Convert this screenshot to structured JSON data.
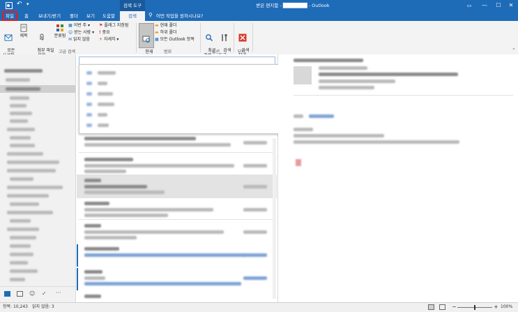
{
  "titlebar": {
    "context_tab": "검색 도구",
    "window_title": "받은 편지함 - ███████ - Outlook",
    "minimize": "—",
    "maximize": "☐",
    "close": "✕"
  },
  "tabs": [
    {
      "label": "파일"
    },
    {
      "label": "홈"
    },
    {
      "label": "보내기/받기"
    },
    {
      "label": "폴더"
    },
    {
      "label": "보기"
    },
    {
      "label": "도움말"
    },
    {
      "label": "검색"
    }
  ],
  "tell_me": "어떤 작업을 원하시나요?",
  "ribbon": {
    "all_mailbox": "모든\n사서함",
    "flag_title": "제목",
    "attachment": "첨부 파일\n있음",
    "categorized": "분류됨",
    "this_week": "이번 주 ▾",
    "sent_to": "받는 사람 ▾",
    "unread": "읽지 않음",
    "flagged": "플래그 지정됨",
    "important": "중요",
    "more": "자세히 ▾",
    "group_refine": "고급 검색",
    "current_mailbox": "현재\n사서함",
    "current_folder": "현재 폴더",
    "subfolders": "하위 폴더",
    "all_outlook": "모든 Outlook 항목",
    "group_scope": "범위",
    "recent": "최근\n검색 ▾",
    "tools": "검색\n도구 ▾",
    "group_options": "옵션",
    "close_search": "검색\n닫기",
    "group_close": "닫기"
  },
  "status": {
    "items": "항목: 10,243",
    "unread": "읽지 않음: 3",
    "zoom": "100%"
  },
  "colors": {
    "accent": "#1e6bb8",
    "close_red": "#d9372b",
    "highlight": "#e02020"
  }
}
